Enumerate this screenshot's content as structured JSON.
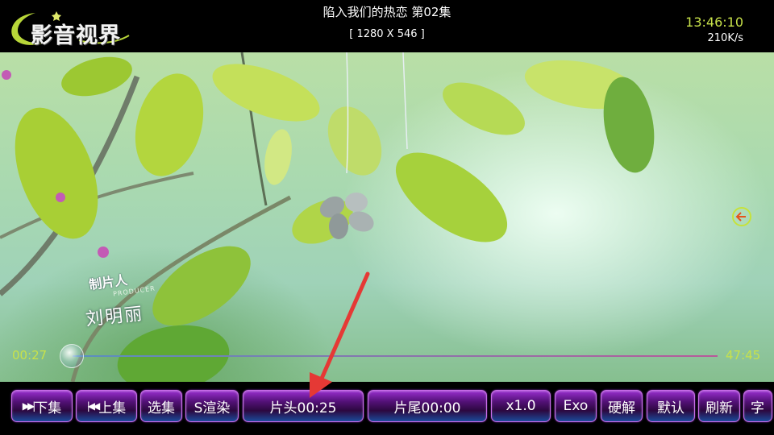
{
  "app": {
    "logo_text": "影音视界"
  },
  "header": {
    "title": "陷入我们的热恋 第02集",
    "resolution": "[ 1280 X 546 ]",
    "clock": "13:46:10",
    "net_speed": "210K/s"
  },
  "video": {
    "credit_role": "制片人",
    "credit_role_en": "PRODUCER",
    "credit_name": "刘明丽",
    "side_icon": "back-arrow-icon"
  },
  "progress": {
    "current": "00:27",
    "total": "47:45"
  },
  "controls": {
    "next_label": "下集",
    "prev_label": "上集",
    "select_label": "选集",
    "render_label": "S渲染",
    "intro_label": "片头00:25",
    "outro_label": "片尾00:00",
    "speed_label": "x1.0",
    "player_label": "Exo",
    "decode_label": "硬解",
    "scale_label": "默认",
    "refresh_label": "刷新",
    "subtitle_label": "字",
    "next_icon": "skip-next-icon",
    "prev_icon": "skip-previous-icon"
  },
  "colors": {
    "accent": "#c8e24a",
    "button_border": "#c96be8",
    "annotation_arrow": "#e53935"
  }
}
